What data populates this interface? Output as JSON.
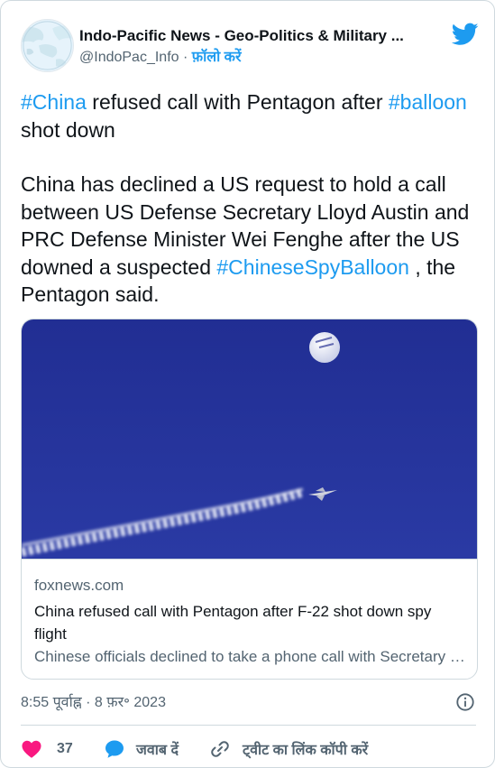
{
  "author": {
    "display_name": "Indo-Pacific News - Geo-Politics & Military ...",
    "handle": "@IndoPac_Info",
    "separator": " · ",
    "follow_label": "फ़ॉलो करें"
  },
  "icons": {
    "platform": "twitter-bird-icon",
    "info": "info-icon",
    "like": "heart-icon",
    "reply": "speech-bubble-icon",
    "copy": "link-icon"
  },
  "tweet": {
    "line1": [
      {
        "text": "#China",
        "hashtag": true
      },
      {
        "text": " refused call with Pentagon after ",
        "hashtag": false
      },
      {
        "text": "#balloon",
        "hashtag": true
      },
      {
        "text": " shot down",
        "hashtag": false
      }
    ],
    "line2": [
      {
        "text": "China has declined a US request to hold a call between US Defense Secretary Lloyd Austin and PRC Defense Minister Wei Fenghe after the US downed a suspected ",
        "hashtag": false
      },
      {
        "text": "#ChineseSpyBalloon",
        "hashtag": true
      },
      {
        "text": " , the Pentagon said.",
        "hashtag": false
      }
    ]
  },
  "link_card": {
    "domain": "foxnews.com",
    "title": "China refused call with Pentagon after F-22 shot down spy flight",
    "description": "Chinese officials declined to take a phone call with Secretary of Defense Lloyd Austin"
  },
  "meta": {
    "timestamp": "8:55 पूर्वाह्न · 8 फ़र॰ 2023"
  },
  "actions": {
    "like_count": "37",
    "reply_label": "जवाब दें",
    "copy_label": "ट्वीट का लिंक कॉपी करें"
  },
  "colors": {
    "accent": "#1d9bf0",
    "like": "#f91880",
    "text": "#0f1419",
    "secondary": "#536471",
    "border": "#cfd9de",
    "sky": "#24329a"
  }
}
